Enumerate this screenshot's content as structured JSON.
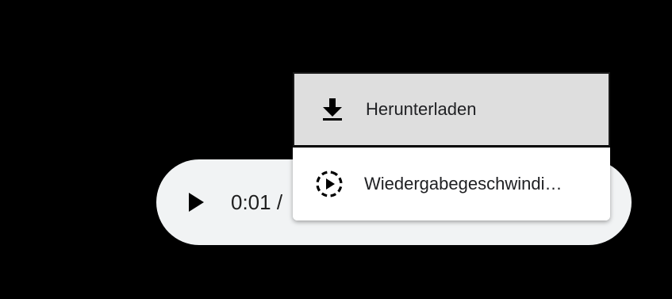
{
  "player": {
    "play_icon": "play-icon",
    "time_text": "0:01 /"
  },
  "menu": {
    "items": [
      {
        "label": "Herunterladen",
        "icon": "download-icon"
      },
      {
        "label": "Wiedergabegeschwindi…",
        "icon": "playback-speed-icon"
      }
    ]
  },
  "colors": {
    "background": "#000000",
    "player_bg": "#f1f3f4",
    "menu_bg": "#ffffff",
    "hover_bg": "#dedede",
    "text": "#202124"
  }
}
